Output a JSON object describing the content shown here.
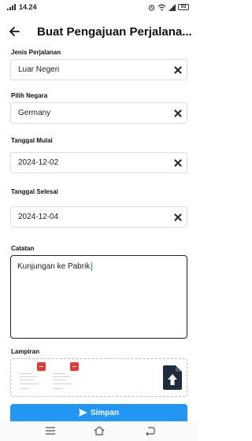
{
  "status_bar": {
    "time": "14.24",
    "battery": "93",
    "icons": [
      "signal-icon",
      "alarm-icon",
      "wifi-icon",
      "mobile-signal-icon",
      "battery-icon"
    ]
  },
  "header": {
    "title": "Buat Pengajuan Perjalana..."
  },
  "form": {
    "jenis_perjalanan": {
      "label": "Jenis Perjalanan",
      "value": "Luar Negeri"
    },
    "negara": {
      "label": "Pilih Negara",
      "value": "Germany"
    },
    "tanggal_mulai": {
      "label": "Tanggal Mulai",
      "value": "2024-12-02"
    },
    "tanggal_selesai": {
      "label": "Tanggal Selesai",
      "value": "2024-12-04"
    },
    "catatan": {
      "label": "Catatan",
      "value": "Kunjungan ke Pabrik"
    },
    "lampiran": {
      "label": "Lampiran"
    }
  },
  "save_label": "Simpan",
  "colors": {
    "primary": "#2196f3",
    "remove_badge": "#e53935",
    "text": "#111111",
    "border": "#dcdcdc"
  }
}
